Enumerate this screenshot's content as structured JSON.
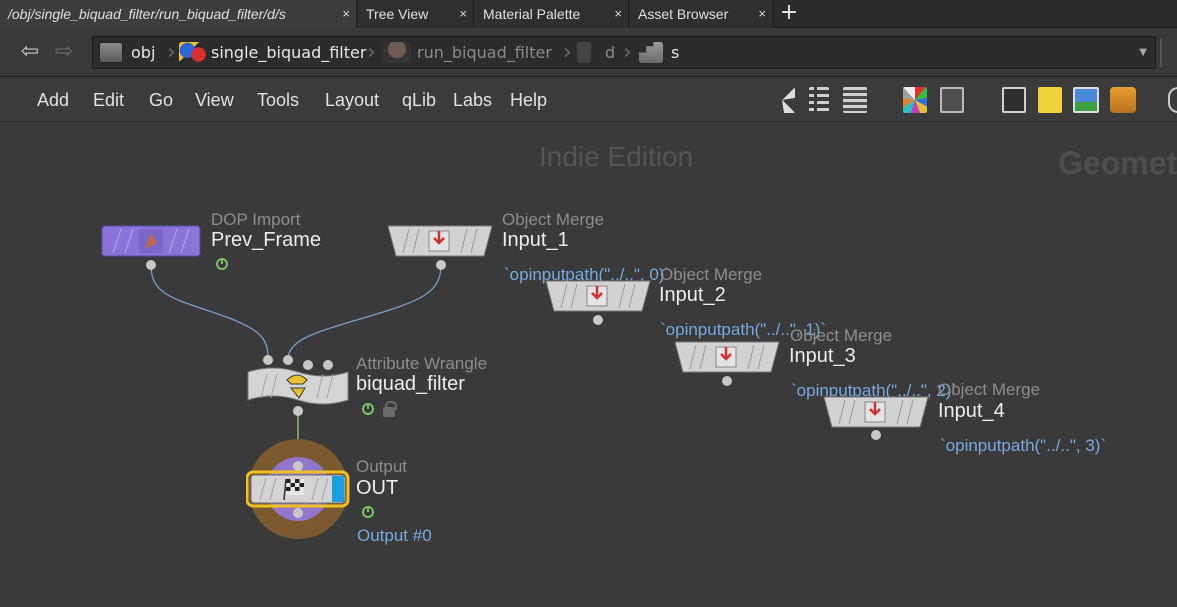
{
  "tabs": [
    {
      "label": "/obj/single_biquad_filter/run_biquad_filter/d/s",
      "active": true
    },
    {
      "label": "Tree View",
      "active": false
    },
    {
      "label": "Material Palette",
      "active": false
    },
    {
      "label": "Asset Browser",
      "active": false
    }
  ],
  "tab_close": "×",
  "tab_add": "+",
  "nav": {
    "back": "⇦",
    "forward": "⇨"
  },
  "breadcrumbs": [
    {
      "label": "obj",
      "icon": "obj-icon"
    },
    {
      "label": "single_biquad_filter",
      "icon": "geo-icon"
    },
    {
      "label": "run_biquad_filter",
      "icon": "dopnet-icon",
      "dim": true
    },
    {
      "label": "d",
      "icon": "dopobject-icon",
      "dim": true
    },
    {
      "label": "s",
      "icon": "sop-icon"
    }
  ],
  "menus": [
    "Add",
    "Edit",
    "Go",
    "View",
    "Tools",
    "Layout",
    "qLib",
    "Labs",
    "Help"
  ],
  "toolbar_icons": [
    "tools-icon",
    "tree-icon",
    "list-icon",
    "color-palette-icon",
    "shape-palette-icon",
    "network-box-icon",
    "sticky-note-icon",
    "image-icon",
    "subnet-icon"
  ],
  "watermark": "Indie Edition",
  "context_label": "Geometry",
  "nodes": {
    "prev_frame": {
      "type": "DOP Import",
      "name": "Prev_Frame"
    },
    "input_1": {
      "type": "Object Merge",
      "name": "Input_1",
      "expr": "`opinputpath(\"../..\", 0)`"
    },
    "input_2": {
      "type": "Object Merge",
      "name": "Input_2",
      "expr": "`opinputpath(\"../..\", 1)`"
    },
    "input_3": {
      "type": "Object Merge",
      "name": "Input_3",
      "expr": "`opinputpath(\"../..\", 2)`"
    },
    "input_4": {
      "type": "Object Merge",
      "name": "Input_4",
      "expr": "`opinputpath(\"../..\", 3)`"
    },
    "biquad_filter": {
      "type": "Attribute Wrangle",
      "name": "biquad_filter"
    },
    "out": {
      "type": "Output",
      "name": "OUT",
      "output_label": "Output #0"
    }
  },
  "colors": {
    "dop_import": "#8a74d8",
    "merge": "#c8c8c8",
    "output_ring": "#7a5a2e",
    "output_inner": "#9276cc",
    "selected": "#f0c020",
    "display_flag": "#1aa0e0",
    "wire": "#7a9cc8"
  }
}
